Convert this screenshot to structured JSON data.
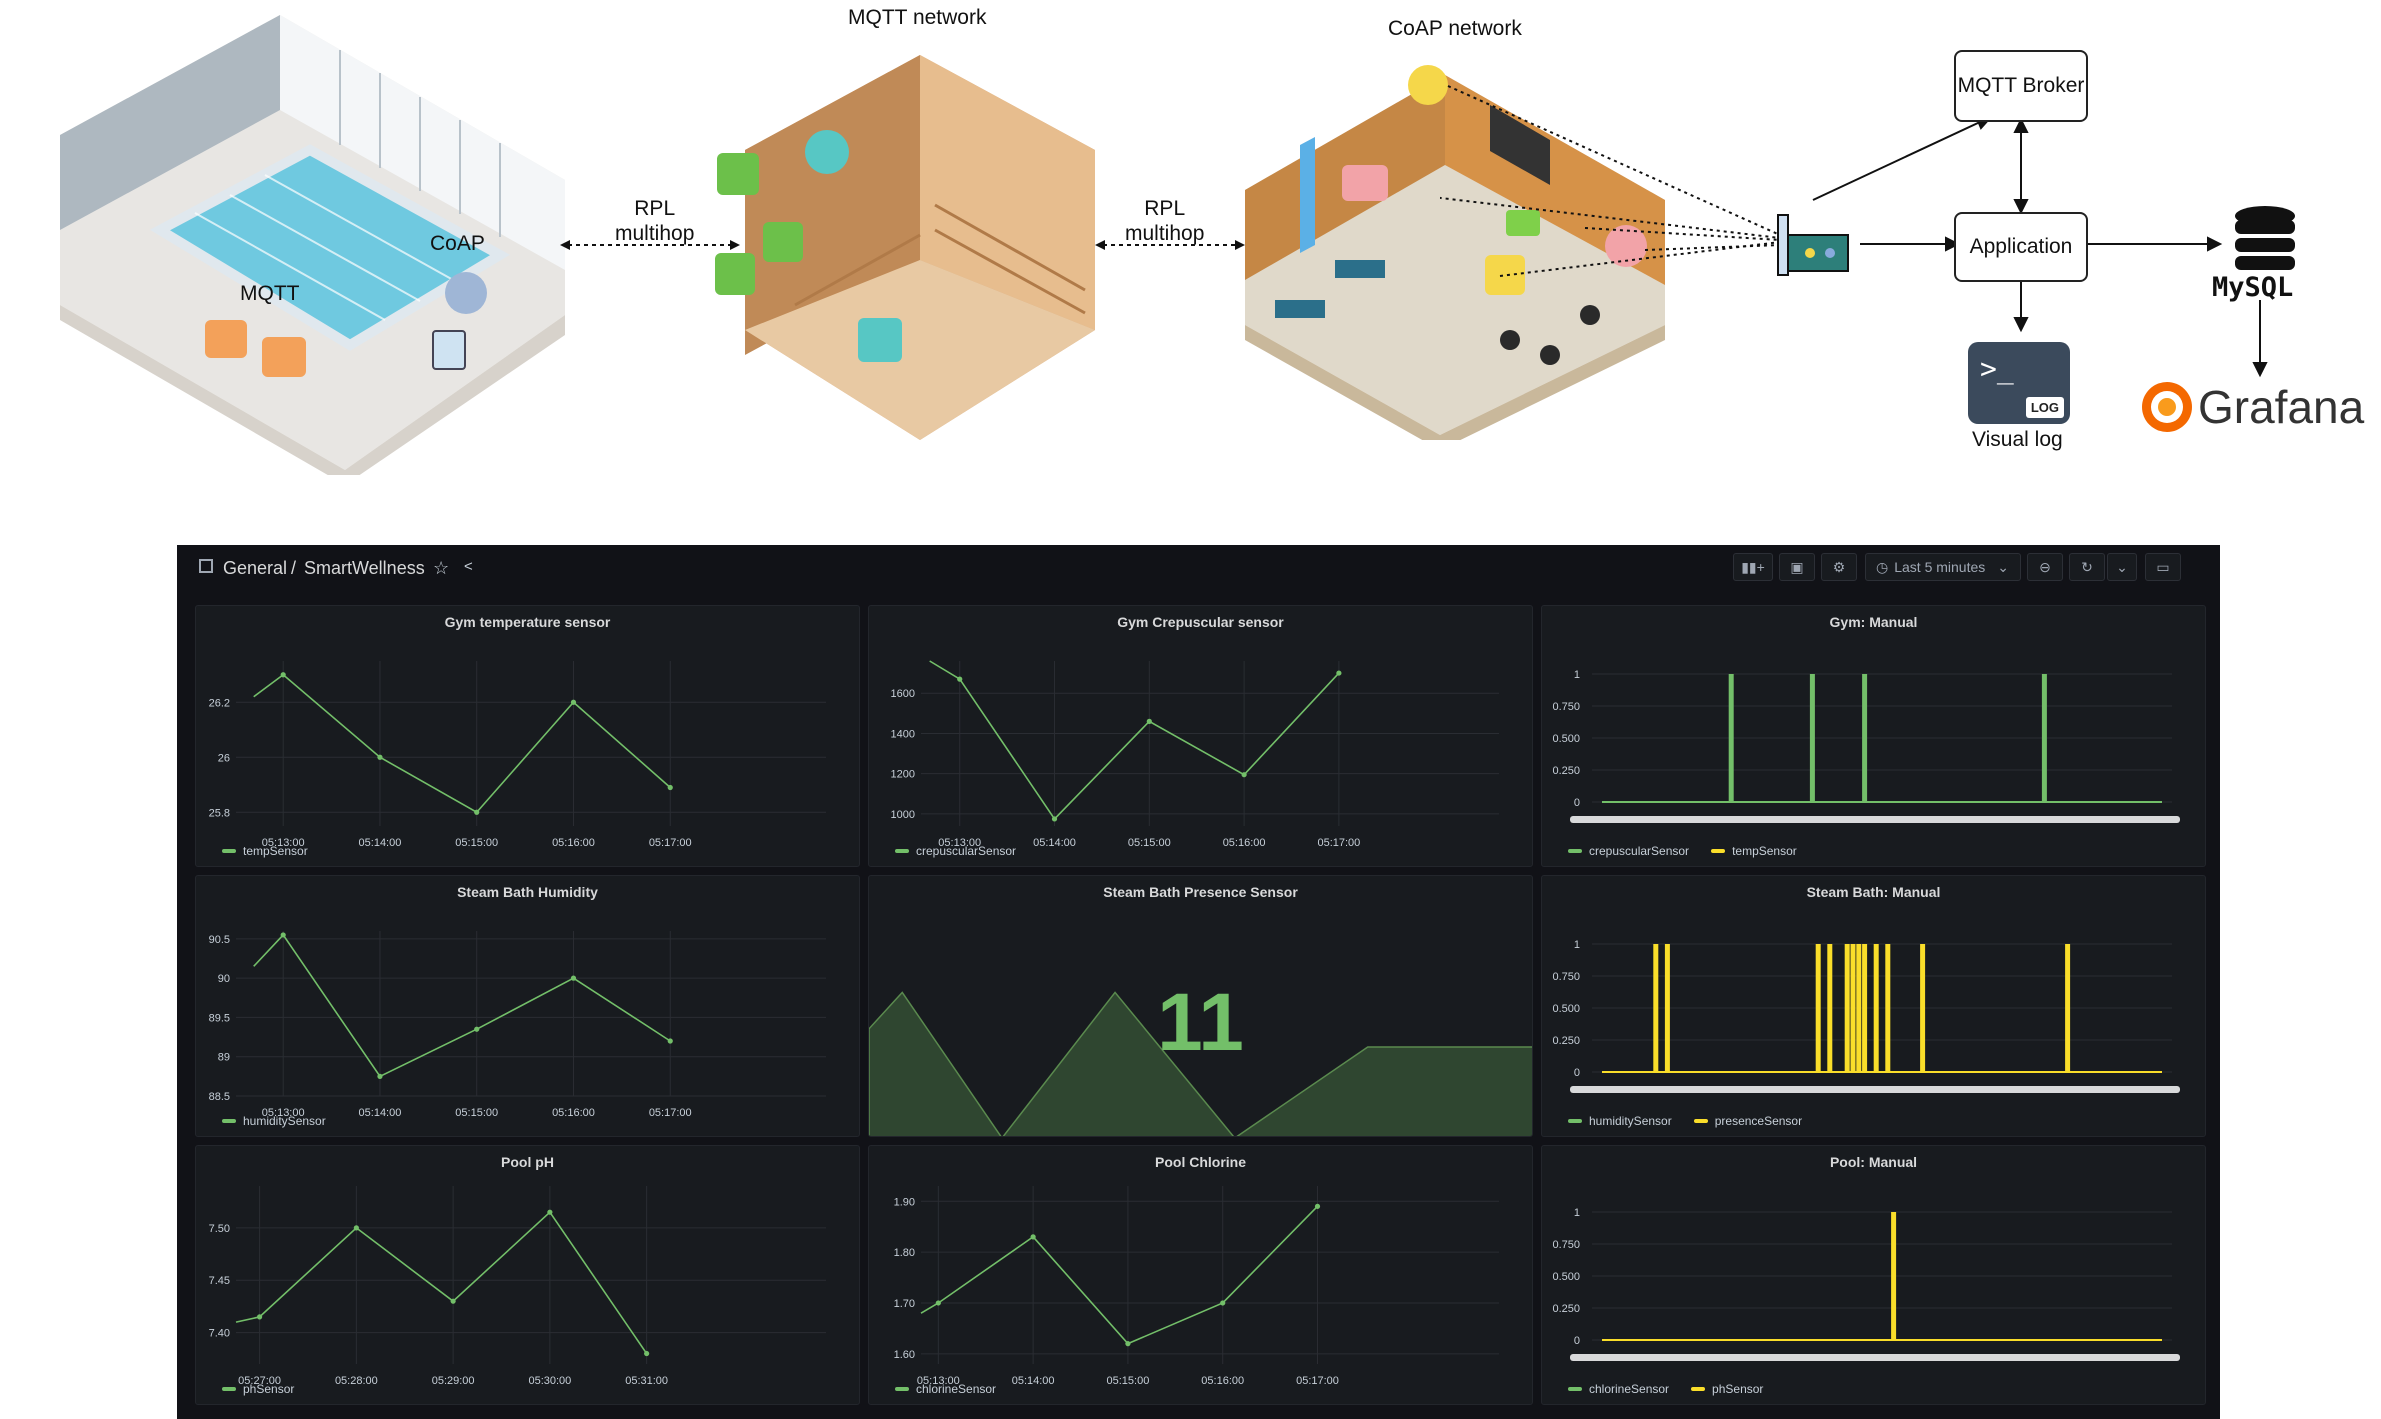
{
  "diagram": {
    "mqtt_network": "MQTT network",
    "coap_network": "CoAP network",
    "rpl_left": [
      "RPL",
      "multihop"
    ],
    "rpl_right": [
      "RPL",
      "multihop"
    ],
    "pool_coap": "CoAP",
    "pool_mqtt": "MQTT",
    "mqtt_broker": "MQTT Broker",
    "application": "Application",
    "visual_log": "Visual log",
    "mysql": "MySQL",
    "grafana": "Grafana",
    "log_icon_text": "LOG"
  },
  "dashboard": {
    "breadcrumb_folder": "General",
    "breadcrumb_sep": "/",
    "breadcrumb_title": "SmartWellness",
    "time_range": "Last 5 minutes",
    "colors": {
      "green": "#73bf69",
      "yellow": "#fade2a",
      "bg": "#111217",
      "panel": "#181b1f"
    },
    "panels": {
      "gym_temp": {
        "title": "Gym temperature sensor",
        "legend": [
          "tempSensor"
        ],
        "y_ticks": [
          "26.2",
          "26",
          "25.8"
        ],
        "x_ticks": [
          "05:13:00",
          "05:14:00",
          "05:15:00",
          "05:16:00",
          "05:17:00"
        ]
      },
      "gym_crep": {
        "title": "Gym Crepuscular sensor",
        "legend": [
          "crepuscularSensor"
        ],
        "y_ticks": [
          "1600",
          "1400",
          "1200",
          "1000"
        ],
        "x_ticks": [
          "05:13:00",
          "05:14:00",
          "05:15:00",
          "05:16:00",
          "05:17:00"
        ]
      },
      "gym_manual": {
        "title": "Gym: Manual",
        "legend": [
          "crepuscularSensor",
          "tempSensor"
        ],
        "y_ticks": [
          "1",
          "0.750",
          "0.500",
          "0.250",
          "0"
        ]
      },
      "steam_hum": {
        "title": "Steam Bath Humidity",
        "legend": [
          "humiditySensor"
        ],
        "y_ticks": [
          "90.5",
          "90",
          "89.5",
          "89",
          "88.5"
        ],
        "x_ticks": [
          "05:13:00",
          "05:14:00",
          "05:15:00",
          "05:16:00",
          "05:17:00"
        ]
      },
      "steam_presence": {
        "title": "Steam Bath Presence Sensor",
        "value": "11"
      },
      "steam_manual": {
        "title": "Steam Bath: Manual",
        "legend": [
          "humiditySensor",
          "presenceSensor"
        ],
        "y_ticks": [
          "1",
          "0.750",
          "0.500",
          "0.250",
          "0"
        ]
      },
      "pool_ph": {
        "title": "Pool pH",
        "legend": [
          "phSensor"
        ],
        "y_ticks": [
          "7.50",
          "7.45",
          "7.40"
        ],
        "x_ticks": [
          "05:27:00",
          "05:28:00",
          "05:29:00",
          "05:30:00",
          "05:31:00"
        ]
      },
      "pool_cl": {
        "title": "Pool Chlorine",
        "legend": [
          "chlorineSensor"
        ],
        "y_ticks": [
          "1.90",
          "1.80",
          "1.70",
          "1.60"
        ],
        "x_ticks": [
          "05:13:00",
          "05:14:00",
          "05:15:00",
          "05:16:00",
          "05:17:00"
        ]
      },
      "pool_manual": {
        "title": "Pool: Manual",
        "legend": [
          "chlorineSensor",
          "phSensor"
        ],
        "y_ticks": [
          "1",
          "0.750",
          "0.500",
          "0.250",
          "0"
        ]
      }
    }
  },
  "chart_data": [
    {
      "type": "line",
      "title": "Gym temperature sensor",
      "x": [
        "05:12:50",
        "05:13:00",
        "05:14:00",
        "05:15:00",
        "05:16:00",
        "05:17:00"
      ],
      "series": [
        {
          "name": "tempSensor",
          "values": [
            26.22,
            26.3,
            26.0,
            25.8,
            26.2,
            25.89
          ]
        }
      ],
      "ylim": [
        25.75,
        26.35
      ]
    },
    {
      "type": "line",
      "title": "Gym Crepuscular sensor",
      "x": [
        "05:12:50",
        "05:13:00",
        "05:14:00",
        "05:15:00",
        "05:16:00",
        "05:17:00"
      ],
      "series": [
        {
          "name": "crepuscularSensor",
          "values": [
            1760,
            1670,
            975,
            1460,
            1195,
            1700
          ]
        }
      ],
      "ylim": [
        940,
        1760
      ]
    },
    {
      "type": "bar",
      "title": "Gym: Manual",
      "series": [
        {
          "name": "crepuscularSensor",
          "pulses": [
            0.24,
            0.38,
            0.47,
            0.78
          ]
        }
      ],
      "ylim": [
        0,
        1
      ]
    },
    {
      "type": "line",
      "title": "Steam Bath Humidity",
      "x": [
        "05:12:50",
        "05:13:00",
        "05:14:00",
        "05:15:00",
        "05:16:00",
        "05:17:00"
      ],
      "series": [
        {
          "name": "humiditySensor",
          "values": [
            90.15,
            90.55,
            88.75,
            89.35,
            90.0,
            89.2
          ]
        }
      ],
      "ylim": [
        88.5,
        90.6
      ]
    },
    {
      "type": "area",
      "title": "Steam Bath Presence Sensor",
      "series": [
        {
          "name": "presenceSensor",
          "values": [
            0.6,
            0.8,
            0,
            0.8,
            0,
            0.5
          ]
        }
      ],
      "ylim": [
        0,
        1
      ]
    },
    {
      "type": "bar",
      "title": "Steam Bath: Manual",
      "series": [
        {
          "name": "presenceSensor",
          "pulses": [
            0.11,
            0.13,
            0.39,
            0.41,
            0.44,
            0.45,
            0.46,
            0.47,
            0.49,
            0.51,
            0.57,
            0.82
          ]
        }
      ],
      "ylim": [
        0,
        1
      ]
    },
    {
      "type": "line",
      "title": "Pool pH",
      "x": [
        "05:26:40",
        "05:27:00",
        "05:28:00",
        "05:29:00",
        "05:30:00",
        "05:31:00"
      ],
      "series": [
        {
          "name": "phSensor",
          "values": [
            7.41,
            7.415,
            7.5,
            7.43,
            7.515,
            7.38
          ]
        }
      ],
      "ylim": [
        7.37,
        7.54
      ]
    },
    {
      "type": "line",
      "title": "Pool Chlorine",
      "x": [
        "05:12:50",
        "05:13:00",
        "05:14:00",
        "05:15:00",
        "05:16:00",
        "05:17:00"
      ],
      "series": [
        {
          "name": "chlorineSensor",
          "values": [
            1.68,
            1.7,
            1.83,
            1.62,
            1.7,
            1.89
          ]
        }
      ],
      "ylim": [
        1.58,
        1.93
      ]
    },
    {
      "type": "bar",
      "title": "Pool: Manual",
      "series": [
        {
          "name": "phSensor",
          "pulses": [
            0.52
          ]
        }
      ],
      "ylim": [
        0,
        1
      ]
    }
  ]
}
